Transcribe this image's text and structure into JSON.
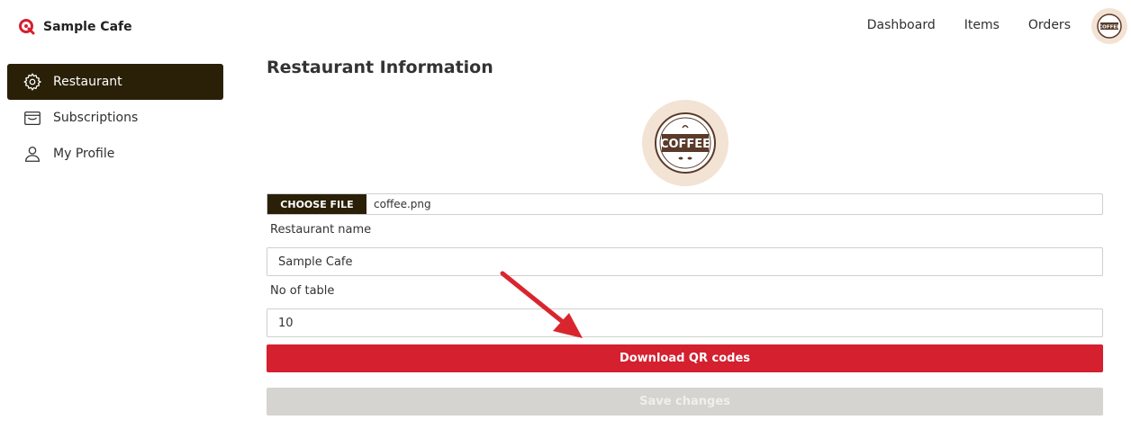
{
  "brand": {
    "name": "Sample Cafe",
    "logo_icon": "q-logo-icon",
    "accent": "#d4202f"
  },
  "nav": [
    {
      "label": "Dashboard"
    },
    {
      "label": "Items"
    },
    {
      "label": "Orders"
    }
  ],
  "avatar": {
    "icon": "coffee-badge-icon",
    "text": "COFFEE"
  },
  "sidebar": {
    "items": [
      {
        "label": "Restaurant",
        "icon": "gear-icon",
        "active": true
      },
      {
        "label": "Subscriptions",
        "icon": "wallet-icon",
        "active": false
      },
      {
        "label": "My Profile",
        "icon": "user-icon",
        "active": false
      }
    ]
  },
  "main": {
    "title": "Restaurant Information",
    "logo_text": "COFFEE",
    "file": {
      "button_label": "CHOOSE FILE",
      "file_name": "coffee.png"
    },
    "restaurant_name": {
      "label": "Restaurant name",
      "value": "Sample Cafe"
    },
    "tables": {
      "label": "No of table",
      "value": "10"
    },
    "download_label": "Download QR codes",
    "save_label": "Save changes"
  },
  "colors": {
    "dark": "#2a2008",
    "red": "#d4202f",
    "disabled": "#d6d4d0",
    "logo_bg": "#f3e3d5"
  }
}
